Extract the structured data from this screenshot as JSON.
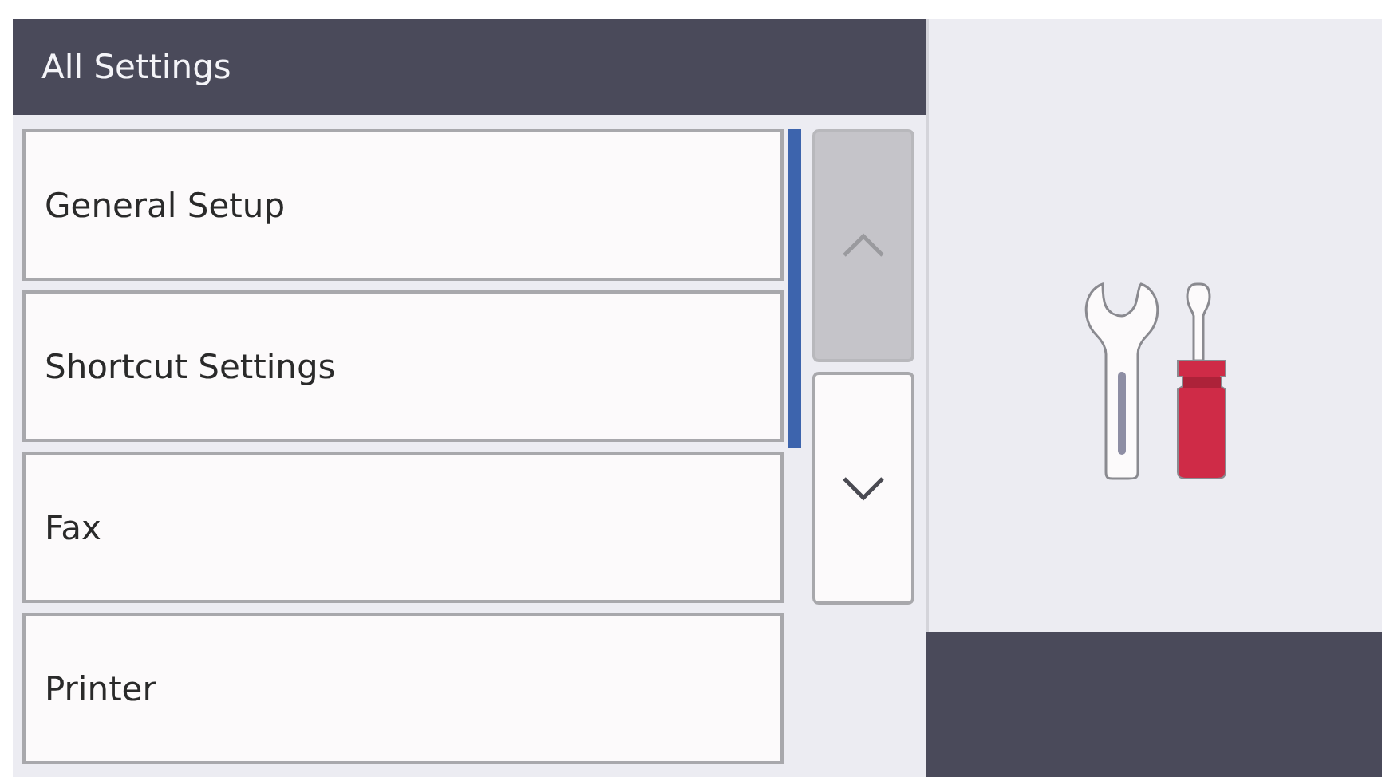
{
  "header": {
    "title": "All Settings"
  },
  "menu_items": [
    {
      "label": "General Setup"
    },
    {
      "label": "Shortcut Settings"
    },
    {
      "label": "Fax"
    },
    {
      "label": "Printer"
    }
  ],
  "scroll_buttons": [
    {
      "kind": "up",
      "disabled": true
    },
    {
      "kind": "down",
      "disabled": false
    }
  ]
}
